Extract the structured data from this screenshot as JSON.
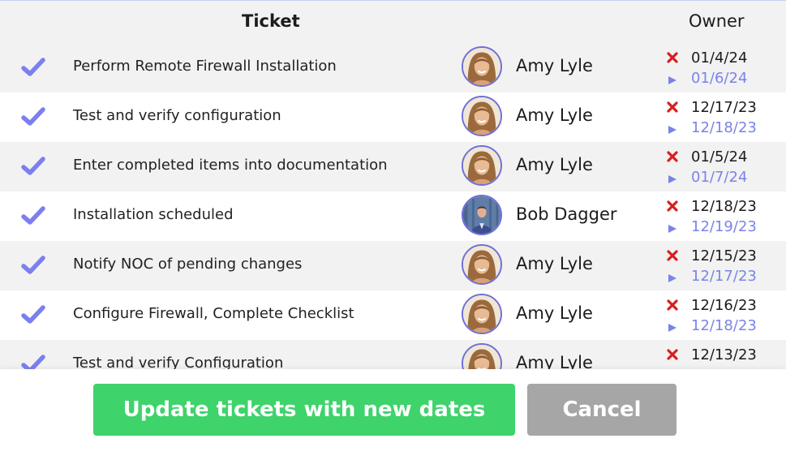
{
  "header": {
    "ticket_label": "Ticket",
    "owner_label": "Owner"
  },
  "tickets": [
    {
      "title": "Perform Remote Firewall Installation",
      "owner": "Amy Lyle",
      "avatar": "amy",
      "old_date": "01/4/24",
      "new_date": "01/6/24"
    },
    {
      "title": "Test and verify configuration",
      "owner": "Amy Lyle",
      "avatar": "amy",
      "old_date": "12/17/23",
      "new_date": "12/18/23"
    },
    {
      "title": "Enter completed items into documentation",
      "owner": "Amy Lyle",
      "avatar": "amy",
      "old_date": "01/5/24",
      "new_date": "01/7/24"
    },
    {
      "title": "Installation scheduled",
      "owner": "Bob Dagger",
      "avatar": "bob",
      "old_date": "12/18/23",
      "new_date": "12/19/23"
    },
    {
      "title": "Notify NOC of pending changes",
      "owner": "Amy Lyle",
      "avatar": "amy",
      "old_date": "12/15/23",
      "new_date": "12/17/23"
    },
    {
      "title": "Configure Firewall, Complete Checklist",
      "owner": "Amy Lyle",
      "avatar": "amy",
      "old_date": "12/16/23",
      "new_date": "12/18/23"
    },
    {
      "title": "Test and verify Configuration",
      "owner": "Amy Lyle",
      "avatar": "amy",
      "old_date": "12/13/23",
      "new_date": ""
    }
  ],
  "icons": {
    "row_check": "check-icon",
    "old_date": "x-icon",
    "new_date": "play-arrow-icon"
  },
  "colors": {
    "accent": "#7a83e8",
    "check": "#7b7ff0",
    "remove": "#d61f1f",
    "update_button": "#3ed36b",
    "cancel_button": "#a6a6a6"
  },
  "footer": {
    "update_label": "Update tickets with new dates",
    "cancel_label": "Cancel"
  }
}
